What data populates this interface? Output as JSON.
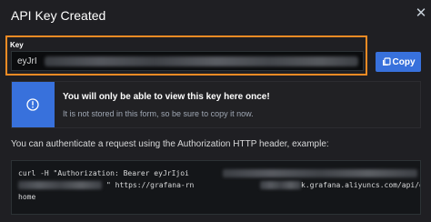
{
  "modal": {
    "title": "API Key Created",
    "close_icon": "close-icon"
  },
  "key_field": {
    "label": "Key",
    "visible_prefix": "eyJrI",
    "highlight_color": "#f08b24"
  },
  "copy_button": {
    "label": "Copy",
    "icon": "copy-icon",
    "color": "#3871dc"
  },
  "info": {
    "title": "You will only be able to view this key here once!",
    "body": "It is not stored in this form, so be sure to copy it now.",
    "icon": "info-circle-icon",
    "accent": "#3871dc"
  },
  "auth_hint": "You can authenticate a request using the Authorization HTTP header, example:",
  "code": {
    "line1": "curl -H \"Authorization: Bearer eyJrIjoi",
    "line2_suffix": "\" https://grafana-rn",
    "line2_end": "k.grafana.aliyuncs.com/api/dashboards/",
    "line3": "home"
  }
}
